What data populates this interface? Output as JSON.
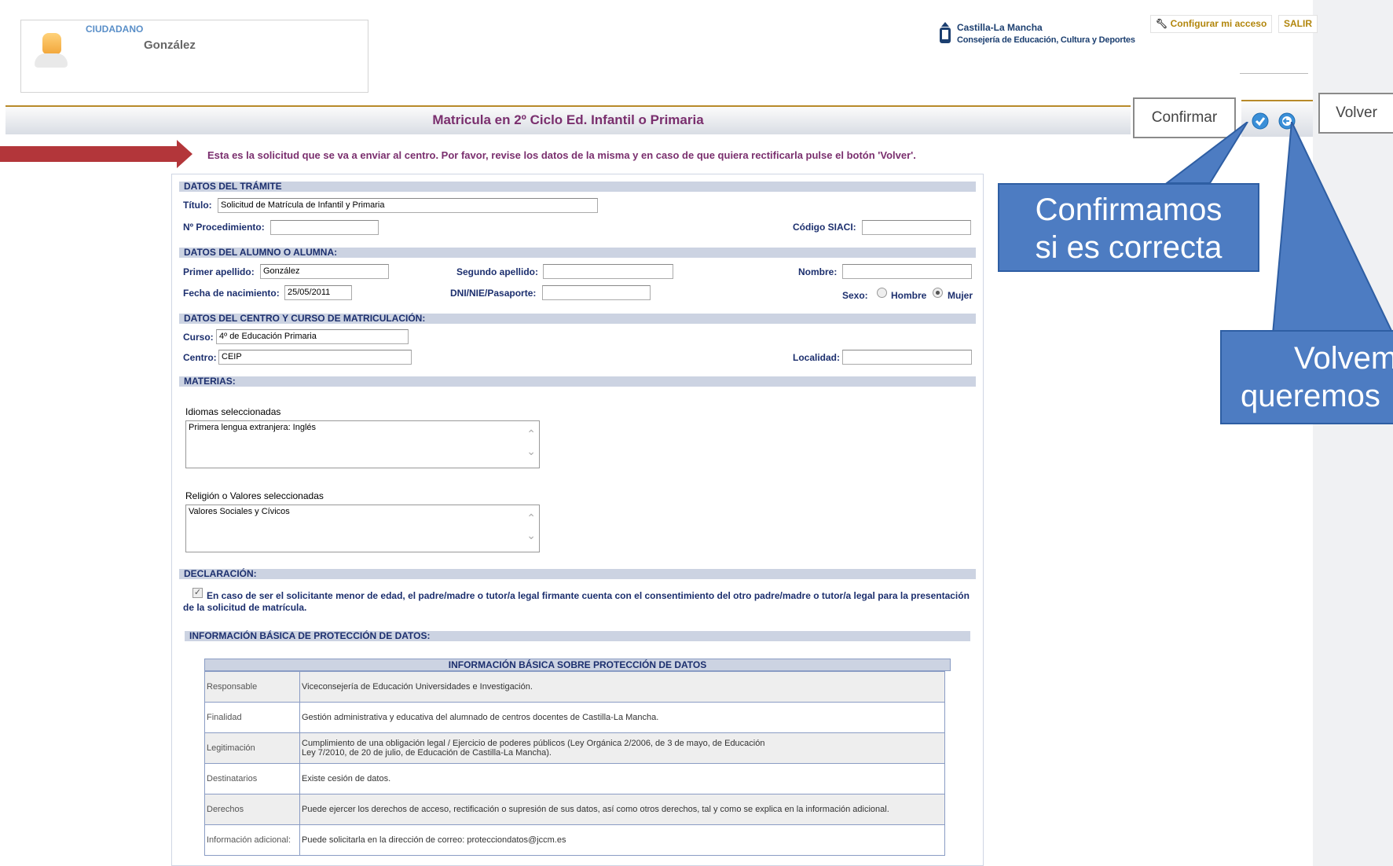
{
  "user": {
    "role": "CIUDADANO",
    "name": "González"
  },
  "logo": {
    "line1": "Castilla-La Mancha",
    "line2": "Consejería de Educación, Cultura y Deportes"
  },
  "header": {
    "configure_label": "Configurar mi acceso",
    "exit_label": "SALIR"
  },
  "page": {
    "title": "Matricula en 2º Ciclo Ed. Infantil o Primaria",
    "message": "Esta es la solicitud que se va a enviar al centro. Por favor, revise los datos de la misma y en caso de que quiera rectificarla pulse el botón 'Volver'."
  },
  "toolbar": {
    "confirm_label": "Confirmar",
    "back_label": "Volver"
  },
  "tramite": {
    "section": "DATOS DEL TRÁMITE",
    "titulo_label": "Título:",
    "titulo_value": "Solicitud de Matrícula de Infantil y Primaria",
    "procedimiento_label": "Nº Procedimiento:",
    "procedimiento_value": "",
    "siaci_label": "Código SIACI:",
    "siaci_value": ""
  },
  "alumno": {
    "section": "DATOS DEL ALUMNO O ALUMNA:",
    "primer_apellido_label": "Primer apellido:",
    "primer_apellido_value": "González",
    "segundo_apellido_label": "Segundo apellido:",
    "segundo_apellido_value": "",
    "nombre_label": "Nombre:",
    "nombre_value": "",
    "fecha_label": "Fecha de nacimiento:",
    "fecha_value": "25/05/2011",
    "dni_label": "DNI/NIE/Pasaporte:",
    "dni_value": "",
    "sexo_label": "Sexo:",
    "sexo_hombre": "Hombre",
    "sexo_mujer": "Mujer",
    "sexo_selected": "Mujer"
  },
  "centro": {
    "section": "DATOS DEL CENTRO Y CURSO DE MATRICULACIÓN:",
    "curso_label": "Curso:",
    "curso_value": "4º de Educación Primaria",
    "centro_label": "Centro:",
    "centro_value": "CEIP",
    "localidad_label": "Localidad:",
    "localidad_value": ""
  },
  "materias": {
    "section": "MATERIAS:",
    "idiomas_label": "Idiomas seleccionadas",
    "idiomas_value": "Primera lengua extranjera: Inglés",
    "religion_label": "Religión o Valores seleccionadas",
    "religion_value": "Valores Sociales y Cívicos"
  },
  "declaracion": {
    "section": "DECLARACIÓN:",
    "checked": true,
    "text": "En caso de ser el solicitante menor de edad, el padre/madre o tutor/a legal firmante cuenta con el consentimiento del otro padre/madre o tutor/a legal para la presentación de la solicitud de matrícula."
  },
  "proteccion": {
    "section": "INFORMACIÓN BÁSICA DE PROTECCIÓN DE DATOS:",
    "table_title": "INFORMACIÓN BÁSICA SOBRE PROTECCIÓN DE DATOS",
    "rows": [
      {
        "key": "Responsable",
        "value": "Viceconsejería de Educación Universidades e Investigación."
      },
      {
        "key": "Finalidad",
        "value": "Gestión administrativa y educativa del alumnado de centros docentes de Castilla-La Mancha."
      },
      {
        "key": "Legitimación",
        "value": "Cumplimiento de una obligación legal / Ejercicio de poderes públicos (Ley Orgánica 2/2006, de 3 de mayo, de Educación",
        "value2": "Ley 7/2010, de 20 de julio, de Educación de Castilla-La Mancha)."
      },
      {
        "key": "Destinatarios",
        "value": "Existe cesión de datos."
      },
      {
        "key": "Derechos",
        "value": "Puede ejercer los derechos de acceso, rectificación o supresión de sus datos, así como otros derechos, tal y como se explica en la información adicional."
      },
      {
        "key": "Información adicional:",
        "value": "Puede solicitarla en la dirección de correo: protecciondatos@jccm.es"
      }
    ]
  },
  "annotations": {
    "callout_confirm": [
      "Confirmamos",
      "si es correcta"
    ],
    "callout_back": [
      "Volvem",
      "queremos"
    ],
    "colors": {
      "callout_fill": "#4d7cc2",
      "arrow": "#b3363a"
    }
  }
}
